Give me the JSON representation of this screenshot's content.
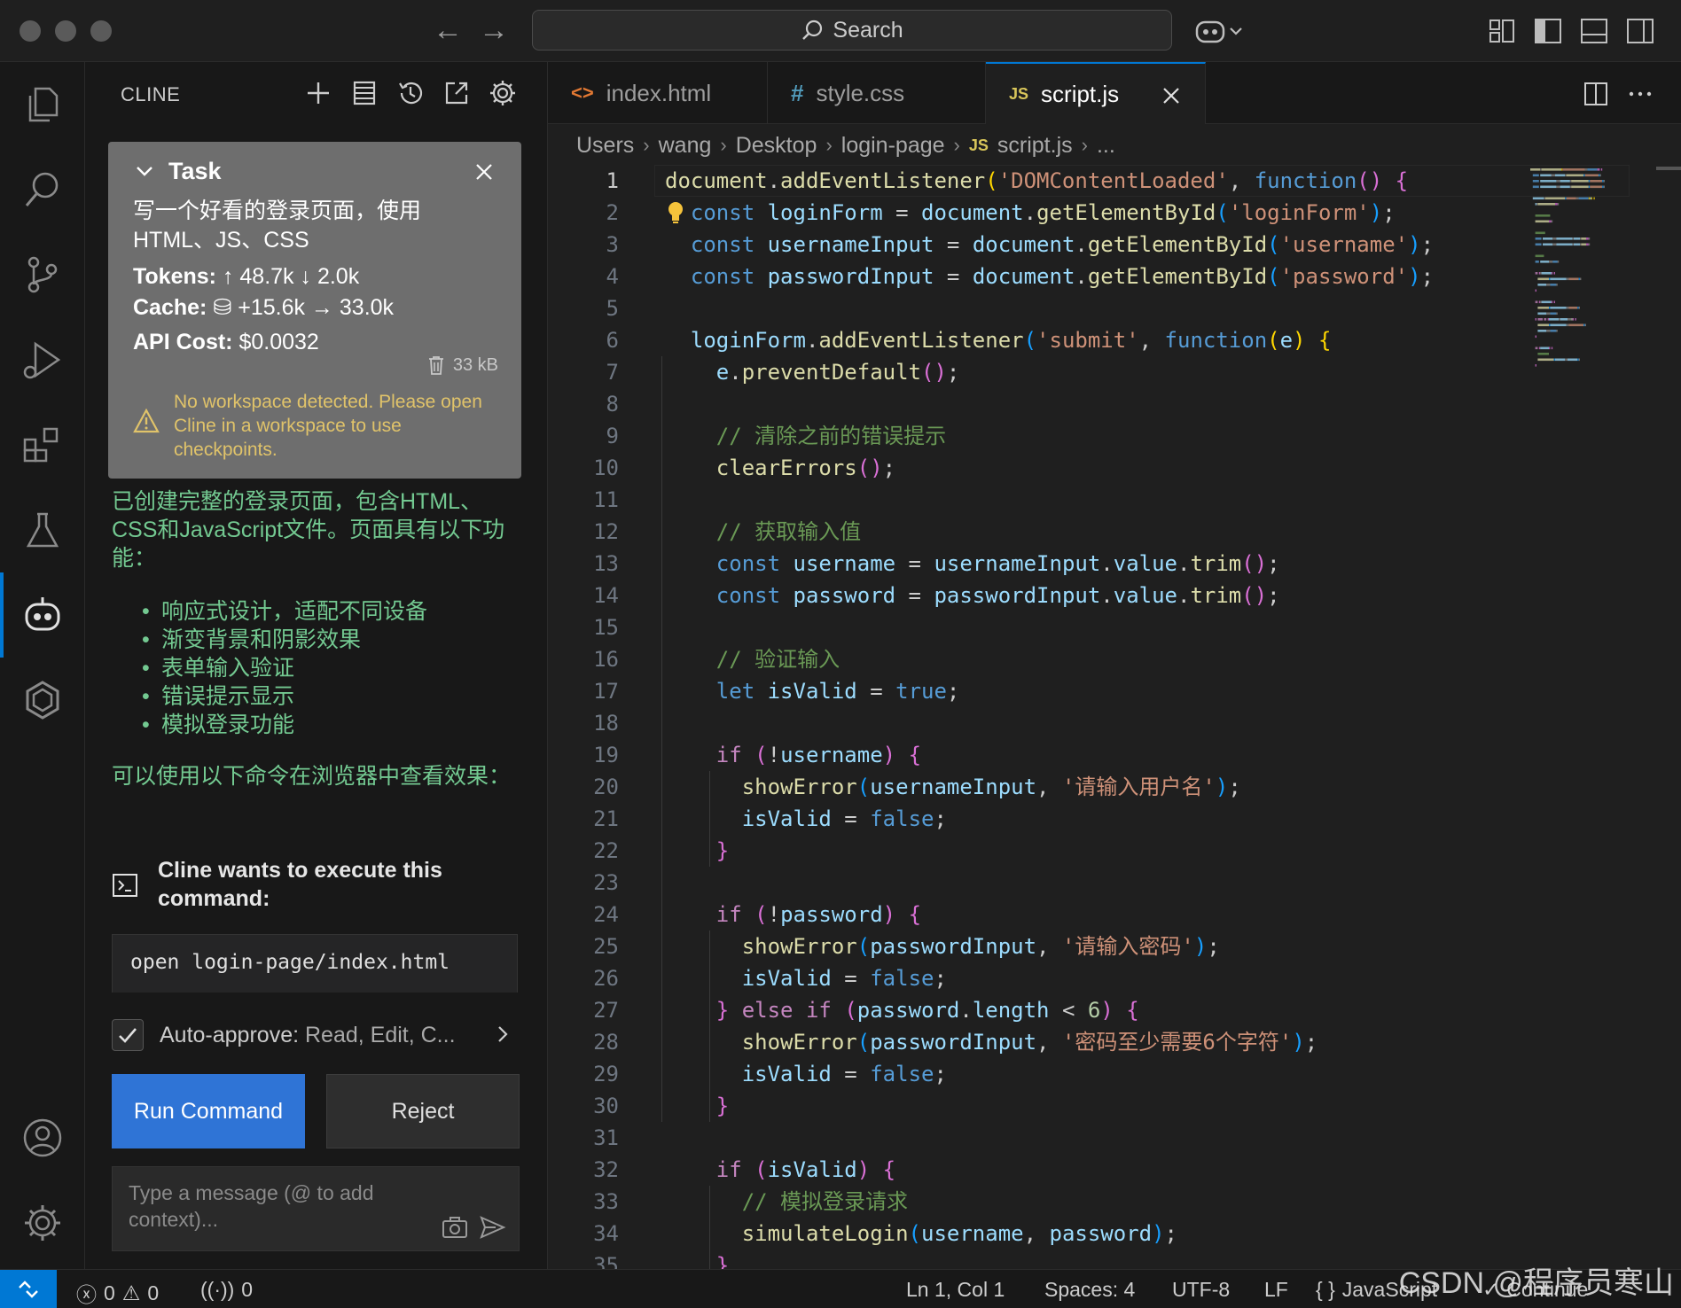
{
  "titlebar": {
    "search_label": "Search"
  },
  "sidebar": {
    "title": "CLINE",
    "task": {
      "label": "Task",
      "description": "写一个好看的登录页面，使用HTML、JS、CSS",
      "tokens_label": "Tokens:",
      "tokens_value": "↑ 48.7k ↓ 2.0k",
      "cache_label": "Cache:",
      "cache_value": "+15.6k → 33.0k",
      "cost_label": "API Cost:",
      "cost_value": "$0.0032",
      "size": "33 kB",
      "warning": "No workspace detected. Please open Cline in a workspace to use checkpoints."
    },
    "chat": {
      "summary": "已创建完整的登录页面，包含HTML、CSS和JavaScript文件。页面具有以下功能：",
      "features": [
        "响应式设计，适配不同设备",
        "渐变背景和阴影效果",
        "表单输入验证",
        "错误提示显示",
        "模拟登录功能"
      ],
      "view_hint": "可以使用以下命令在浏览器中查看效果："
    },
    "command": {
      "heading": "Cline wants to execute this command:",
      "text": "open login-page/index.html"
    },
    "auto_approve": {
      "label": "Auto-approve:",
      "value": "Read, Edit, C..."
    },
    "run_label": "Run Command",
    "reject_label": "Reject",
    "message_placeholder": "Type a message (@ to add context)..."
  },
  "editor": {
    "tabs": [
      {
        "icon": "<>",
        "label": "index.html"
      },
      {
        "icon": "#",
        "label": "style.css"
      },
      {
        "icon": "JS",
        "label": "script.js"
      }
    ],
    "breadcrumb": [
      "Users",
      "wang",
      "Desktop",
      "login-page",
      "script.js",
      "..."
    ],
    "breadcrumb_js_icon": "JS",
    "current_line": 1
  },
  "statusbar": {
    "errors": "0",
    "warnings": "0",
    "ports": "0",
    "position": "Ln 1, Col 1",
    "spaces": "Spaces: 4",
    "encoding": "UTF-8",
    "eol": "LF",
    "language_icon": "{ }",
    "language": "JavaScript",
    "continue": "Continue"
  },
  "watermark": "CSDN @程序员寒山",
  "colors": {
    "accent": "#0078d4",
    "run_button": "#2f74d6",
    "chat_text": "#73c991",
    "warning": "#e0c36a"
  }
}
